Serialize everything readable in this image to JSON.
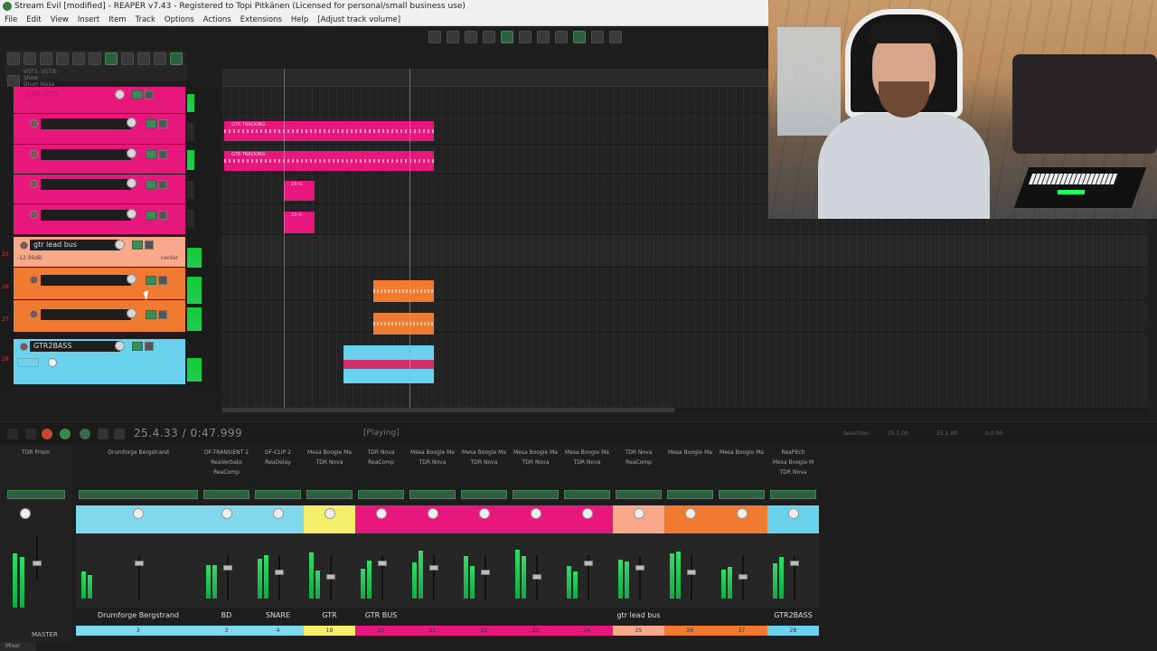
{
  "window": {
    "title": "Stream Evil [modified] - REAPER v7.43 - Registered to Topi Pitkänen (Licensed for personal/small business use)"
  },
  "menu": [
    "File",
    "Edit",
    "View",
    "Insert",
    "Item",
    "Track",
    "Options",
    "Actions",
    "Extensions",
    "Help",
    "[Adjust track volume]"
  ],
  "toolbar": {
    "label1": "VST3: VST3i: Show",
    "label2": "Drum Mesa audio"
  },
  "tracks": [
    {
      "name": "GTR BUS",
      "color": "#e8177e"
    },
    {
      "name": "",
      "color": "#e8177e"
    },
    {
      "name": "",
      "color": "#e8177e"
    },
    {
      "name": "",
      "color": "#e8177e"
    },
    {
      "name": "",
      "color": "#e8177e"
    },
    {
      "name": "gtr lead bus",
      "volume": "-12.96dB",
      "pan": "center",
      "color": "#f9a88a",
      "number": "25"
    },
    {
      "name": "",
      "color": "#ef7a30",
      "number": "26"
    },
    {
      "name": "",
      "color": "#ef7a30",
      "number": "27"
    },
    {
      "name": "GTR2BASS",
      "color": "#6ad2ec",
      "number": "28"
    }
  ],
  "items": {
    "gtr_tracking": "GTR TRACKING",
    "short": "19-G"
  },
  "transport": {
    "time": "25.4.33 / 0:47.999",
    "state": "[Playing]",
    "selection_label": "Selection:",
    "sel_start": "25.1.00",
    "sel_end": "25.1.00",
    "sel_len": "0.0.00"
  },
  "mixer": {
    "master_label": "MASTER",
    "mixer_tab": "Mixer",
    "master_fx": "TDR Prism",
    "strips": [
      {
        "fx": [
          "Drumforge Bergstrand"
        ],
        "name": "Drumforge Bergstrand",
        "number": "2",
        "color": "#7fd8ec"
      },
      {
        "fx": [
          "DF-TRANSIENT 2",
          "ReaVerbate",
          "ReaComp"
        ],
        "name": "BD",
        "number": "3",
        "color": "#7fd8ec"
      },
      {
        "fx": [
          "DF-CLIP 2",
          "ReaDelay"
        ],
        "name": "SNARE",
        "number": "4",
        "color": "#7fd8ec"
      },
      {
        "fx": [
          "Mesa Boogie Ma",
          "TDR Nova"
        ],
        "name": "GTR TRACKING",
        "number": "19",
        "color": "#f4ee6a"
      },
      {
        "fx": [
          "TDR Nova",
          "ReaComp"
        ],
        "name": "GTR BUS",
        "number": "20",
        "color": "#e8177e"
      },
      {
        "fx": [
          "Mesa Boogie Ma",
          "TDR Nova"
        ],
        "name": "",
        "number": "21",
        "color": "#e8177e"
      },
      {
        "fx": [
          "Mesa Boogie Ma",
          "TDR Nova"
        ],
        "name": "",
        "number": "22",
        "color": "#e8177e"
      },
      {
        "fx": [
          "Mesa Boogie Ma",
          "TDR Nova"
        ],
        "name": "",
        "number": "23",
        "color": "#e8177e"
      },
      {
        "fx": [
          "Mesa Boogie Ma",
          "TDR Nova"
        ],
        "name": "",
        "number": "24",
        "color": "#e8177e"
      },
      {
        "fx": [
          "TDR Nova",
          "ReaComp"
        ],
        "name": "gtr lead bus",
        "number": "25",
        "color": "#f9a88a"
      },
      {
        "fx": [
          "Mesa Boogie Ma"
        ],
        "name": "",
        "number": "26",
        "color": "#ef7a30"
      },
      {
        "fx": [
          "Mesa Boogie Ma"
        ],
        "name": "",
        "number": "27",
        "color": "#ef7a30"
      },
      {
        "fx": [
          "ReaPitch",
          "Mesa Boogie M",
          "TDR Nova"
        ],
        "name": "GTR2BASS",
        "number": "28",
        "color": "#6ad2ec"
      }
    ]
  }
}
